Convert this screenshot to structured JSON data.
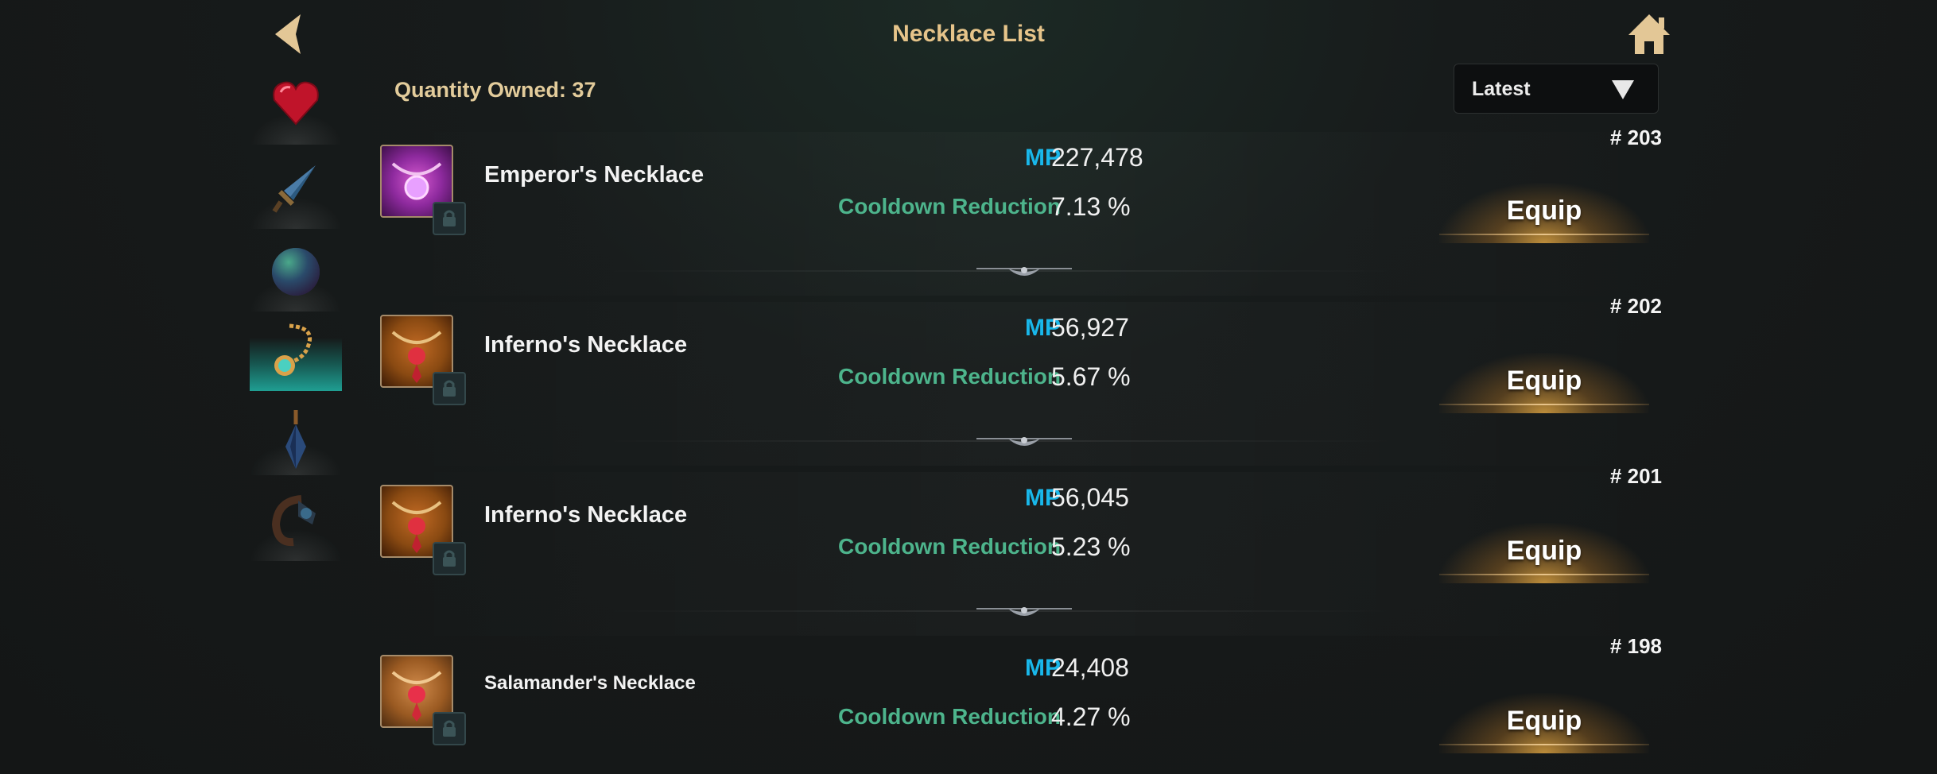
{
  "header": {
    "title": "Necklace List",
    "back_icon": "back-arrow-icon",
    "home_icon": "home-icon"
  },
  "inventory": {
    "quantity_label": "Quantity Owned: 37"
  },
  "sort": {
    "selected": "Latest",
    "icon": "triangle-down-icon"
  },
  "categories": [
    {
      "icon": "heart-gem-icon",
      "active": false
    },
    {
      "icon": "sword-icon",
      "active": false
    },
    {
      "icon": "orb-icon",
      "active": false
    },
    {
      "icon": "necklace-icon",
      "active": true
    },
    {
      "icon": "earring-icon",
      "active": false
    },
    {
      "icon": "bracelet-icon",
      "active": false
    }
  ],
  "items": [
    {
      "number": "# 203",
      "name": "Emperor's Necklace",
      "mp_label": "MP",
      "mp_value": "227,478",
      "cd_label": "Cooldown Reduction",
      "cd_value": "7.13 %",
      "equip_label": "Equip",
      "icon": "emperor-necklace-icon",
      "color": "#8e2a9e"
    },
    {
      "number": "# 202",
      "name": "Inferno's Necklace",
      "mp_label": "MP",
      "mp_value": "56,927",
      "cd_label": "Cooldown Reduction",
      "cd_value": "5.67 %",
      "equip_label": "Equip",
      "icon": "inferno-necklace-icon",
      "color": "#8a4a12"
    },
    {
      "number": "# 201",
      "name": "Inferno's Necklace",
      "mp_label": "MP",
      "mp_value": "56,045",
      "cd_label": "Cooldown Reduction",
      "cd_value": "5.23 %",
      "equip_label": "Equip",
      "icon": "inferno-necklace-icon",
      "color": "#8a4a12"
    },
    {
      "number": "# 198",
      "name": "Salamander's Necklace",
      "mp_label": "MP",
      "mp_value": "24,408",
      "cd_label": "Cooldown Reduction",
      "cd_value": "4.27 %",
      "equip_label": "Equip",
      "icon": "salamander-necklace-icon",
      "color": "#9a5a22"
    }
  ]
}
